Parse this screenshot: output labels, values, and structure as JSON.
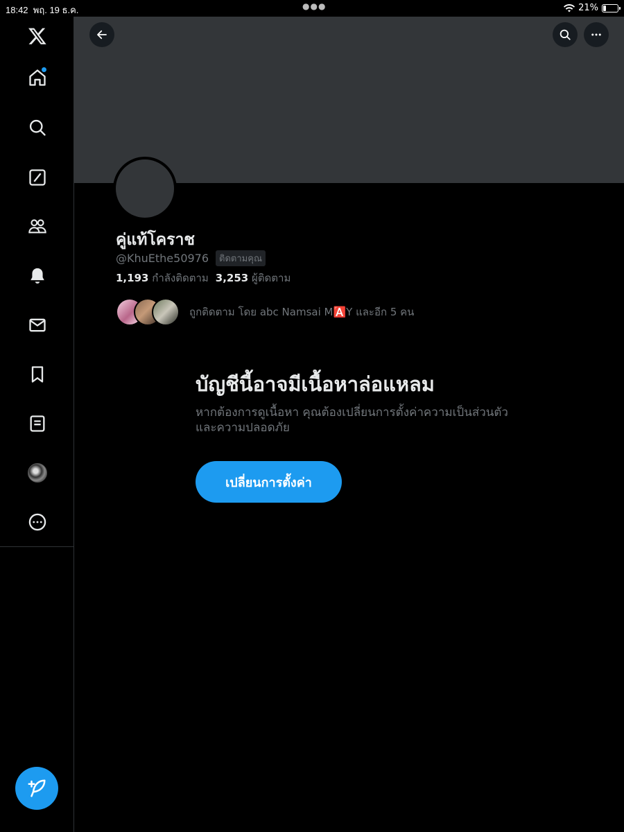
{
  "status_bar": {
    "time": "18:42",
    "date": "พฤ. 19 ธ.ค.",
    "battery_text": "21%",
    "battery_level": 0.21
  },
  "sidebar": {
    "items": [
      {
        "name": "x-logo-icon"
      },
      {
        "name": "home-icon"
      },
      {
        "name": "search-icon"
      },
      {
        "name": "grok-icon"
      },
      {
        "name": "communities-icon"
      },
      {
        "name": "notifications-icon"
      },
      {
        "name": "messages-icon"
      },
      {
        "name": "bookmarks-icon"
      },
      {
        "name": "lists-icon"
      },
      {
        "name": "profile-avatar-icon"
      },
      {
        "name": "more-icon"
      }
    ],
    "compose_icon": "compose-feather-icon"
  },
  "profile": {
    "display_name": "คู่แท้โคราช",
    "handle": "@KhuEthe50976",
    "follows_you": "ติดตามคุณ",
    "following_count": "1,193",
    "following_label": "กำลังติดตาม",
    "followers_count": "3,253",
    "followers_label": "ผู้ติดตาม",
    "followed_by": "ถูกติดตาม โดย abc Namsai M🅰️Y และอีก 5 คน"
  },
  "warning": {
    "title": "บัญชีนี้อาจมีเนื้อหาล่อแหลม",
    "subtitle": "หากต้องการดูเนื้อหา คุณต้องเปลี่ยนการตั้งค่าความเป็นส่วนตัวและความปลอดภัย",
    "button_label": "เปลี่ยนการตั้งค่า"
  },
  "colors": {
    "accent": "#1d9bf0",
    "banner": "#333639",
    "muted_text": "#71767b"
  }
}
